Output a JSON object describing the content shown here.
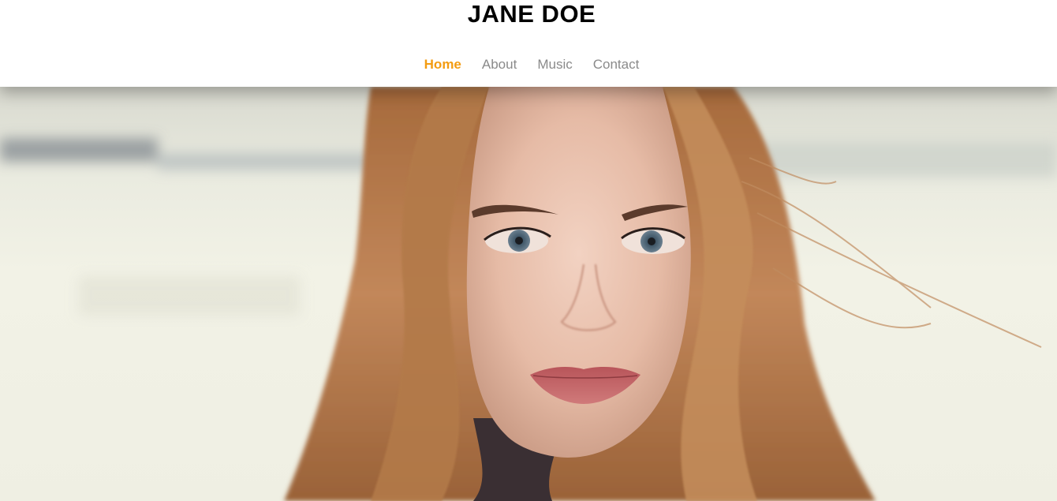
{
  "site": {
    "title": "JANE DOE"
  },
  "nav": {
    "items": [
      {
        "label": "Home",
        "active": true
      },
      {
        "label": "About",
        "active": false
      },
      {
        "label": "Music",
        "active": false
      },
      {
        "label": "Contact",
        "active": false
      }
    ]
  },
  "hero": {
    "image": "portrait photo of a woman with long auburn hair"
  },
  "colors": {
    "accent": "#f39c12",
    "nav_text": "#8a8a8a",
    "title": "#000000"
  }
}
